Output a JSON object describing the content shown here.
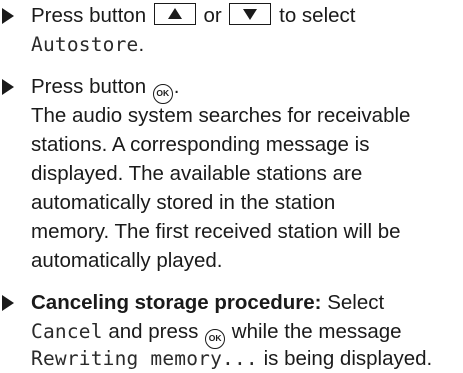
{
  "steps": [
    {
      "text_before": "Press button",
      "up_icon": "up-arrow-button",
      "or_text": "or",
      "down_icon": "down-arrow-button",
      "text_after": "to select",
      "code": "Autostore",
      "code_suffix": "."
    },
    {
      "text_before": "Press button",
      "ok_label": "OK",
      "text_after": ".",
      "description_lines": [
        "The audio system searches for receivable",
        "stations. A corresponding message is",
        "displayed. The available stations are",
        "automatically stored in the station",
        "memory. The first received station will be",
        "automatically played."
      ]
    },
    {
      "bold_label": "Canceling storage procedure:",
      "select_text": "Select",
      "cancel_code": "Cancel",
      "press_text": "and press",
      "ok_label": "OK",
      "while_text": "while the message",
      "message_code": "Rewriting memory...",
      "tail_text": "is being displayed."
    }
  ]
}
